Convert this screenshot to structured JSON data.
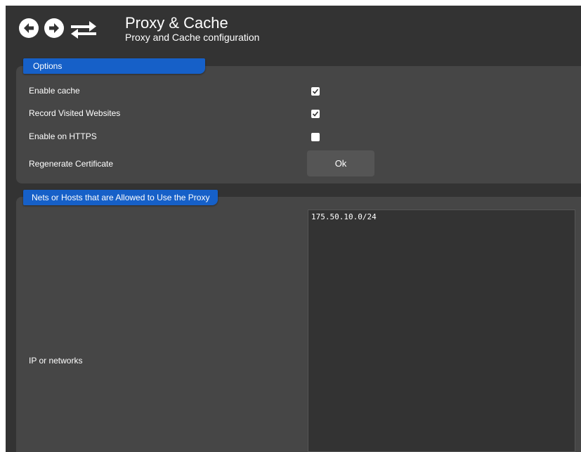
{
  "header": {
    "title": "Proxy & Cache",
    "subtitle": "Proxy and Cache configuration",
    "icons": [
      "back-arrow-icon",
      "forward-arrow-icon",
      "swap-arrows-icon"
    ]
  },
  "options": {
    "legend": "Options",
    "enable_cache": {
      "label": "Enable cache",
      "checked": true
    },
    "record_visited": {
      "label": "Record Visited Websites",
      "checked": true
    },
    "enable_https": {
      "label": "Enable on HTTPS",
      "checked": false
    },
    "regenerate": {
      "label": "Regenerate Certificate",
      "button_label": "Ok"
    }
  },
  "nets": {
    "legend": "Nets or Hosts that are Allowed to Use the Proxy",
    "field_label": "IP or networks",
    "value": "175.50.10.0/24"
  },
  "colors": {
    "background": "#333333",
    "panel": "#464646",
    "accent": "#1660c8"
  }
}
